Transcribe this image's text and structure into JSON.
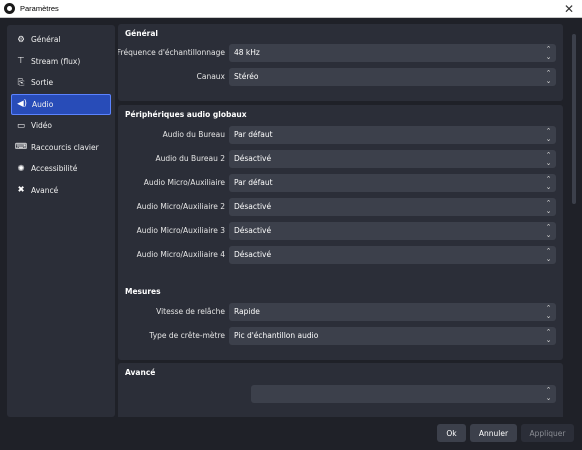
{
  "window": {
    "title": "Paramètres"
  },
  "sidebar": {
    "items": [
      {
        "label": "Général",
        "icon": "gear-icon",
        "glyph": "⚙"
      },
      {
        "label": "Stream (flux)",
        "icon": "antenna-icon",
        "glyph": "📡"
      },
      {
        "label": "Sortie",
        "icon": "output-icon",
        "glyph": "⎘"
      },
      {
        "label": "Audio",
        "icon": "speaker-icon",
        "glyph": "🔊"
      },
      {
        "label": "Vidéo",
        "icon": "monitor-icon",
        "glyph": "▭"
      },
      {
        "label": "Raccourcis clavier",
        "icon": "keyboard-icon",
        "glyph": "⌨"
      },
      {
        "label": "Accessibilité",
        "icon": "accessibility-icon",
        "glyph": "♿"
      },
      {
        "label": "Avancé",
        "icon": "tools-icon",
        "glyph": "✖"
      }
    ],
    "active_index": 3
  },
  "sections": {
    "general": {
      "title": "Général",
      "rows": [
        {
          "label": "Fréquence d'échantillonnage",
          "value": "48 kHz"
        },
        {
          "label": "Canaux",
          "value": "Stéréo"
        }
      ]
    },
    "devices": {
      "title": "Périphériques audio globaux",
      "rows": [
        {
          "label": "Audio du Bureau",
          "value": "Par défaut"
        },
        {
          "label": "Audio du Bureau 2",
          "value": "Désactivé"
        },
        {
          "label": "Audio Micro/Auxiliaire",
          "value": "Par défaut"
        },
        {
          "label": "Audio Micro/Auxiliaire 2",
          "value": "Désactivé"
        },
        {
          "label": "Audio Micro/Auxiliaire 3",
          "value": "Désactivé"
        },
        {
          "label": "Audio Micro/Auxiliaire 4",
          "value": "Désactivé"
        }
      ]
    },
    "meters": {
      "title": "Mesures",
      "rows": [
        {
          "label": "Vitesse de relâche",
          "value": "Rapide"
        },
        {
          "label": "Type de crête-mètre",
          "value": "Pic d'échantillon audio"
        }
      ]
    },
    "advanced": {
      "title": "Avancé"
    }
  },
  "footer": {
    "ok": "Ok",
    "cancel": "Annuler",
    "apply": "Appliquer"
  }
}
